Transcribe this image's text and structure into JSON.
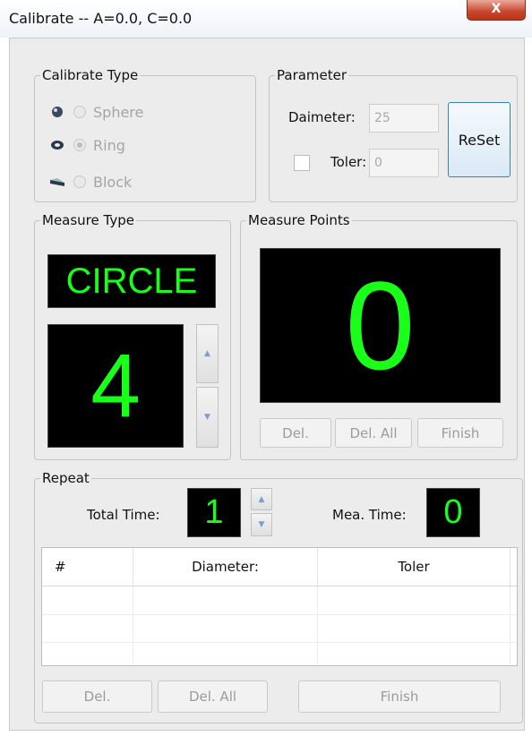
{
  "window": {
    "title": "Calibrate -- A=0.0, C=0.0",
    "close_label": "X"
  },
  "calibrate_type": {
    "legend": "Calibrate Type",
    "options": [
      {
        "label": "Sphere",
        "selected": false
      },
      {
        "label": "Ring",
        "selected": true
      },
      {
        "label": "Block",
        "selected": false
      }
    ]
  },
  "parameter": {
    "legend": "Parameter",
    "diameter_label": "Daimeter:",
    "diameter_value": "25",
    "toler_label": "Toler:",
    "toler_value": "0",
    "toler_checked": false,
    "reset_label": "ReSet"
  },
  "measure_type": {
    "legend": "Measure Type",
    "shape": "CIRCLE",
    "count": "4",
    "up_arrow": "▲",
    "down_arrow": "▼"
  },
  "measure_points": {
    "legend": "Measure Points",
    "value": "0",
    "del_label": "Del.",
    "del_all_label": "Del. All",
    "finish_label": "Finish"
  },
  "repeat": {
    "legend": "Repeat",
    "total_time_label": "Total Time:",
    "total_time_value": "1",
    "mea_time_label": "Mea. Time:",
    "mea_time_value": "0",
    "up_arrow": "▲",
    "down_arrow": "▼",
    "table": {
      "columns": [
        "#",
        "Diameter:",
        "Toler"
      ],
      "rows": [
        [
          "",
          "",
          ""
        ],
        [
          "",
          "",
          ""
        ],
        [
          "",
          "",
          ""
        ]
      ]
    },
    "del_label": "Del.",
    "del_all_label": "Del. All",
    "finish_label": "Finish"
  },
  "colors": {
    "lcd_background": "#000000",
    "lcd_text": "#1aff1a",
    "accent_border": "#3c7fb1"
  }
}
